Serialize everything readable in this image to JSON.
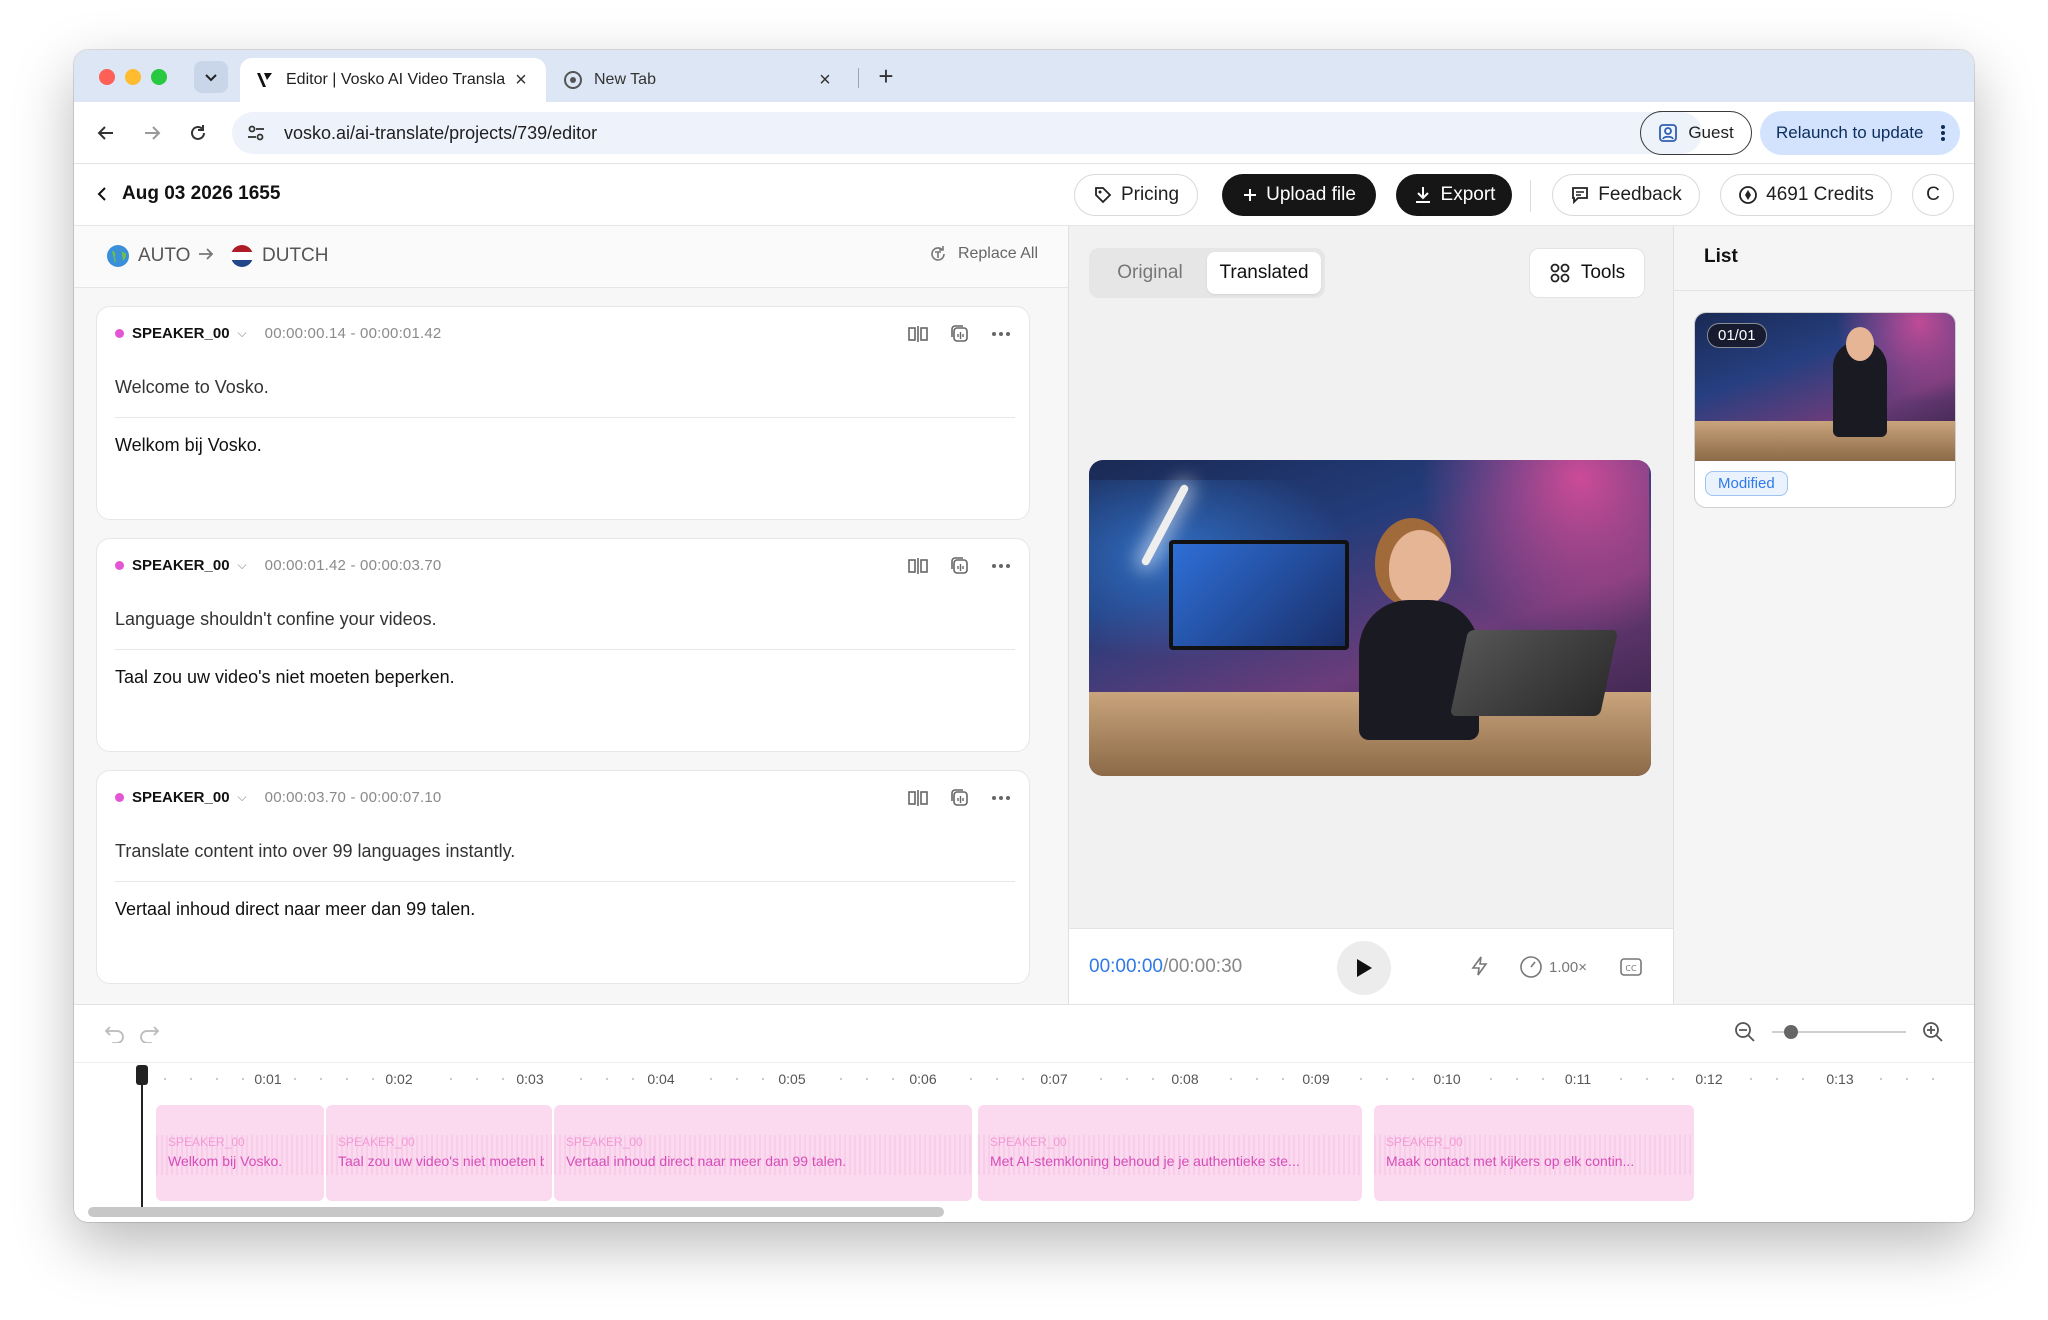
{
  "browser": {
    "tabs": [
      {
        "title": "Editor | Vosko AI Video Transla",
        "active": true
      },
      {
        "title": "New Tab",
        "active": false
      }
    ],
    "url": "vosko.ai/ai-translate/projects/739/editor",
    "guest_label": "Guest",
    "relaunch_label": "Relaunch to update"
  },
  "header": {
    "project_title": "Aug 03 2026 1655",
    "pricing_label": "Pricing",
    "upload_label": "Upload file",
    "export_label": "Export",
    "feedback_label": "Feedback",
    "credits_label": "4691 Credits",
    "avatar_initial": "C"
  },
  "languages": {
    "source": "AUTO",
    "target": "DUTCH",
    "replace_all": "Replace All"
  },
  "segments": [
    {
      "speaker": "SPEAKER_00",
      "timecode": "00:00:00.14 - 00:00:01.42",
      "original": "Welcome to Vosko.",
      "translated": "Welkom bij Vosko."
    },
    {
      "speaker": "SPEAKER_00",
      "timecode": "00:00:01.42 - 00:00:03.70",
      "original": "Language shouldn't confine your videos.",
      "translated": "Taal zou uw video's niet moeten beperken."
    },
    {
      "speaker": "SPEAKER_00",
      "timecode": "00:00:03.70 - 00:00:07.10",
      "original": "Translate content into over 99 languages instantly.",
      "translated": "Vertaal inhoud direct naar meer dan 99 talen."
    }
  ],
  "preview": {
    "toggle_original": "Original",
    "toggle_translated": "Translated",
    "tools_label": "Tools",
    "current_time": "00:00:00",
    "total_time": "/00:00:30",
    "speed": "1.00×"
  },
  "list": {
    "title": "List",
    "count": "01/01",
    "status": "Modified"
  },
  "timeline": {
    "ticks": [
      "0:01",
      "0:02",
      "0:03",
      "0:04",
      "0:05",
      "0:06",
      "0:07",
      "0:08",
      "0:09",
      "0:10",
      "0:11",
      "0:12",
      "0:13"
    ],
    "clips": [
      {
        "speaker": "SPEAKER_00",
        "text": "Welkom bij Vosko."
      },
      {
        "speaker": "SPEAKER_00",
        "text": "Taal zou uw video's niet moeten be..."
      },
      {
        "speaker": "SPEAKER_00",
        "text": "Vertaal inhoud direct naar meer dan 99 talen."
      },
      {
        "speaker": "SPEAKER_00",
        "text": "Met AI-stemkloning behoud je je authentieke ste..."
      },
      {
        "speaker": "SPEAKER_00",
        "text": "Maak contact met kijkers op elk contin..."
      }
    ]
  },
  "colors": {
    "accent_blue": "#2f7ae5",
    "speaker_dot": "#e255d4",
    "clip_bg": "#fbd9ef",
    "clip_text": "#d64db8"
  }
}
